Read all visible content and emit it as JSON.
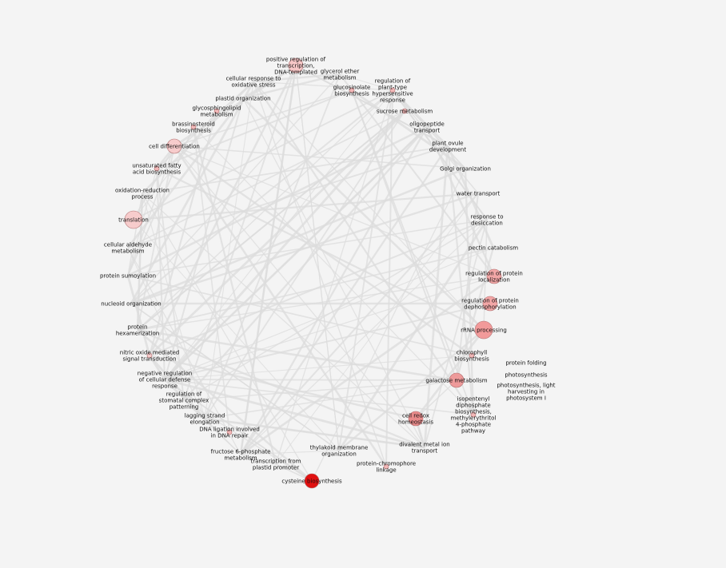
{
  "background_color": "#f4f4f4",
  "edge_color": "#dcdcdc",
  "node_stroke_color": "#b07070",
  "nodes": [
    {
      "id": "n1",
      "label": [
        "positive regulation of",
        "transcription,",
        "DNA-templated"
      ],
      "color": "#f6c6c6",
      "size": "medium"
    },
    {
      "id": "n2",
      "label": [
        "glycerol ether",
        "metabolism"
      ],
      "color": "",
      "size": "none"
    },
    {
      "id": "n3",
      "label": [
        "glucosinolate",
        "biosynthesis"
      ],
      "color": "#f2b8b8",
      "size": "small"
    },
    {
      "id": "n4",
      "label": [
        "regulation of",
        "plant-type",
        "hypersensitive",
        "response"
      ],
      "color": "#f2b8b8",
      "size": "small"
    },
    {
      "id": "n5",
      "label": [
        "sucrose metabolism"
      ],
      "color": "#f2b8b8",
      "size": "small"
    },
    {
      "id": "n6",
      "label": [
        "cellular response to",
        "oxidative stress"
      ],
      "color": "",
      "size": "none"
    },
    {
      "id": "n7",
      "label": [
        "plastid organization"
      ],
      "color": "",
      "size": "none"
    },
    {
      "id": "n8",
      "label": [
        "glycosphingolipid",
        "metabolism"
      ],
      "color": "#f2b8b8",
      "size": "small"
    },
    {
      "id": "n9",
      "label": [
        "brassinosteroid",
        "biosynthesis"
      ],
      "color": "#f2b8b8",
      "size": "small"
    },
    {
      "id": "n10",
      "label": [
        "cell differentiation"
      ],
      "color": "#f7cccc",
      "size": "medium"
    },
    {
      "id": "n11",
      "label": [
        "unsaturated fatty",
        "acid biosynthesis"
      ],
      "color": "#f2b8b8",
      "size": "small"
    },
    {
      "id": "n12",
      "label": [
        "oxidation-reduction",
        "process"
      ],
      "color": "",
      "size": "none"
    },
    {
      "id": "n13",
      "label": [
        "translation"
      ],
      "color": "#f7cccc",
      "size": "large"
    },
    {
      "id": "n14",
      "label": [
        "cellular aldehyde",
        "metabolism"
      ],
      "color": "",
      "size": "none"
    },
    {
      "id": "n15",
      "label": [
        "protein sumoylation"
      ],
      "color": "",
      "size": "none"
    },
    {
      "id": "n16",
      "label": [
        "nucleoid organization"
      ],
      "color": "",
      "size": "none"
    },
    {
      "id": "n17",
      "label": [
        "protein",
        "hexamerization"
      ],
      "color": "",
      "size": "none"
    },
    {
      "id": "n18",
      "label": [
        "nitric oxide mediated",
        "signal transduction"
      ],
      "color": "#f7cccc",
      "size": "small"
    },
    {
      "id": "n19",
      "label": [
        "negative regulation",
        "of cellular defense",
        "response"
      ],
      "color": "",
      "size": "none"
    },
    {
      "id": "n20",
      "label": [
        "regulation of",
        "stomatal complex",
        "patterning"
      ],
      "color": "",
      "size": "none"
    },
    {
      "id": "n21",
      "label": [
        "lagging strand",
        "elongation"
      ],
      "color": "",
      "size": "none"
    },
    {
      "id": "n22",
      "label": [
        "DNA ligation involved",
        "in DNA repair"
      ],
      "color": "#f2b8b8",
      "size": "small"
    },
    {
      "id": "n23",
      "label": [
        "fructose 6-phosphate",
        "metabolism"
      ],
      "color": "",
      "size": "none"
    },
    {
      "id": "n24",
      "label": [
        "transcription from",
        "plastid promoter"
      ],
      "color": "",
      "size": "none"
    },
    {
      "id": "n25",
      "label": [
        "cysteine biosynthesis"
      ],
      "color": "#e01010",
      "size": "medium"
    },
    {
      "id": "n26",
      "label": [
        "thylakoid membrane",
        "organization"
      ],
      "color": "",
      "size": "none"
    },
    {
      "id": "n27",
      "label": [
        "protein-chromophore",
        "linkage"
      ],
      "color": "#f2b8b8",
      "size": "small"
    },
    {
      "id": "n28",
      "label": [
        "divalent metal ion",
        "transport"
      ],
      "color": "",
      "size": "none"
    },
    {
      "id": "n29",
      "label": [
        "cell redox",
        "homeostasis"
      ],
      "color": "#e88a8a",
      "size": "medium"
    },
    {
      "id": "n30",
      "label": [
        "isopentenyl",
        "diphosphate",
        "biosynthesis,",
        "methylerythritol",
        "4-phosphate",
        "pathway"
      ],
      "color": "#f2b8b8",
      "size": "small"
    },
    {
      "id": "n31",
      "label": [
        "galactose metabolism"
      ],
      "color": "#ee9a9a",
      "size": "medium"
    },
    {
      "id": "n32",
      "label": [
        "chlorophyll",
        "biosynthesis"
      ],
      "color": "#f2b8b8",
      "size": "small"
    },
    {
      "id": "n33",
      "label": [
        "rRNA processing"
      ],
      "color": "#f29a9a",
      "size": "large"
    },
    {
      "id": "n34",
      "label": [
        "regulation of protein",
        "dephosphorylation"
      ],
      "color": "#f2a6a6",
      "size": "medium"
    },
    {
      "id": "n35",
      "label": [
        "regulation of protein",
        "localization"
      ],
      "color": "#f2a6a6",
      "size": "medium"
    },
    {
      "id": "n36",
      "label": [
        "pectin catabolism"
      ],
      "color": "",
      "size": "none"
    },
    {
      "id": "n37",
      "label": [
        "response to",
        "desiccation"
      ],
      "color": "",
      "size": "none"
    },
    {
      "id": "n38",
      "label": [
        "water transport"
      ],
      "color": "",
      "size": "none"
    },
    {
      "id": "n39",
      "label": [
        "Golgi organization"
      ],
      "color": "",
      "size": "none"
    },
    {
      "id": "n40",
      "label": [
        "plant ovule",
        "development"
      ],
      "color": "",
      "size": "none"
    },
    {
      "id": "n41",
      "label": [
        "oligopeptide",
        "transport"
      ],
      "color": "",
      "size": "none"
    },
    {
      "id": "n42",
      "label": [
        "protein folding"
      ],
      "color": "",
      "size": "none"
    },
    {
      "id": "n43",
      "label": [
        "photosynthesis"
      ],
      "color": "",
      "size": "none"
    },
    {
      "id": "n44",
      "label": [
        "photosynthesis, light",
        "harvesting in",
        "photosystem I"
      ],
      "color": "",
      "size": "none"
    }
  ]
}
